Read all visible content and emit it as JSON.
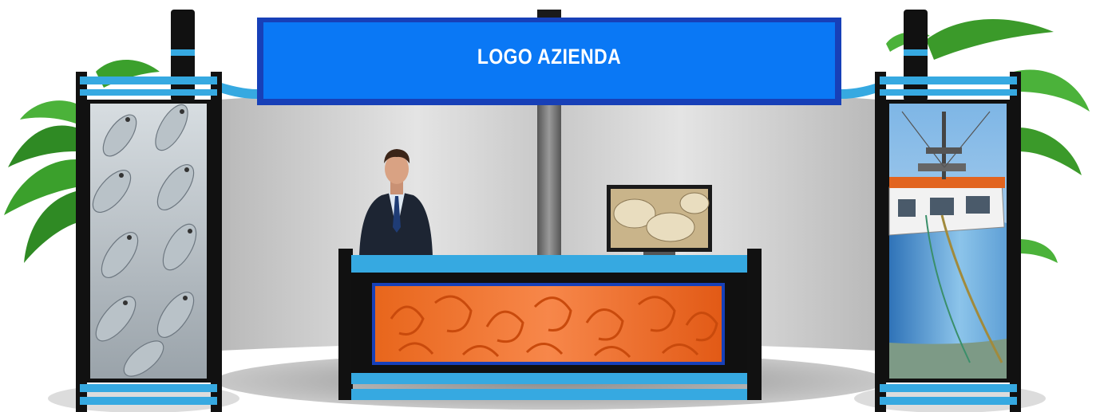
{
  "banner": {
    "logo_text": "LOGO AZIENDA"
  },
  "colors": {
    "banner_blue": "#0a78f5",
    "banner_border": "#1740b8",
    "accent_cyan": "#36a9e1",
    "frame_black": "#111111",
    "wall_grey": "#cfcfcf"
  },
  "panels": {
    "left_image": "fish-on-ice",
    "right_image": "fishing-boat",
    "counter_image": "shrimp",
    "monitor_image": "scallop-shells"
  }
}
